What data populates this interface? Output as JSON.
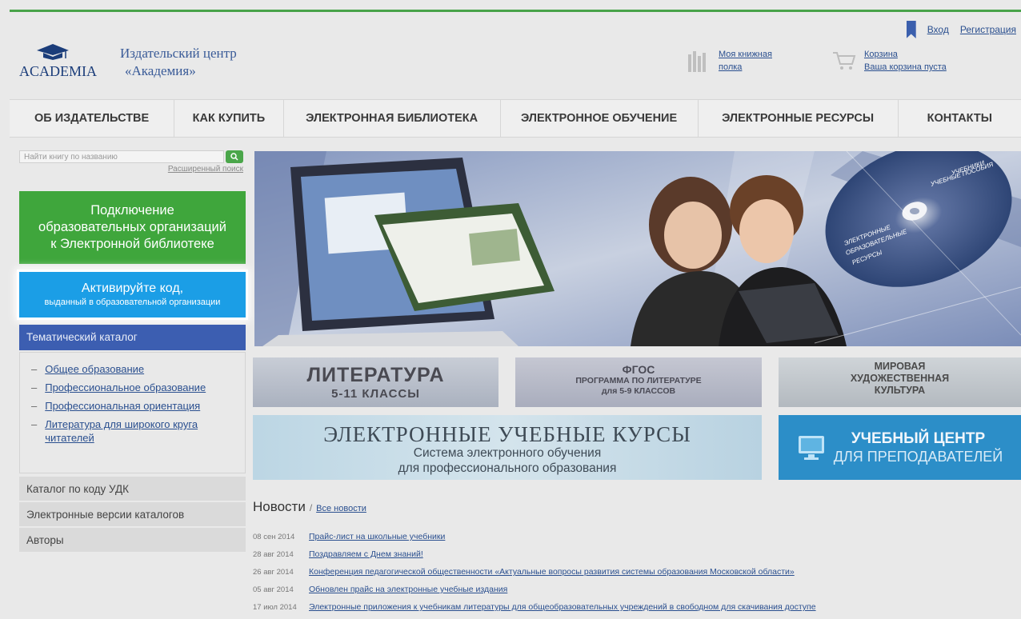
{
  "auth": {
    "login": "Вход",
    "register": "Регистрация"
  },
  "logo": {
    "name": "ACADEMIA"
  },
  "brand": {
    "line1": "Издательский центр",
    "line2": "«Академия»"
  },
  "shelf": {
    "line1": "Моя книжная",
    "line2": "полка"
  },
  "cart": {
    "title": "Корзина",
    "status": "Ваша корзина пуста"
  },
  "nav": [
    "ОБ ИЗДАТЕЛЬСТВЕ",
    "КАК КУПИТЬ",
    "ЭЛЕКТРОННАЯ БИБЛИОТЕКА",
    "ЭЛЕКТРОННОЕ ОБУЧЕНИЕ",
    "ЭЛЕКТРОННЫЕ РЕСУРСЫ",
    "КОНТАКТЫ"
  ],
  "search": {
    "placeholder": "Найти книгу по названию",
    "advanced": "Расширенный поиск"
  },
  "green_button": {
    "line1": "Подключение",
    "line2": "образовательных организаций",
    "line3": "к Электронной библиотеке"
  },
  "blue_button": {
    "line1": "Активируйте код,",
    "line2": "выданный в образовательной организации"
  },
  "catalog": {
    "title": "Тематический каталог",
    "items": [
      "Общее образование",
      "Профессиональное образование",
      "Профессиональная ориентация",
      "Литература для широкого круга читателей"
    ]
  },
  "side_items": [
    "Каталог по коду УДК",
    "Электронные версии каталогов",
    "Авторы"
  ],
  "banner": {
    "disc_top_1": "УЧЕБНИКИ",
    "disc_top_2": "УЧЕБНЫЕ ПОСОБИЯ",
    "disc_1": "ЭЛЕКТРОННЫЕ",
    "disc_2": "ОБРАЗОВАТЕЛЬНЫЕ",
    "disc_3": "РЕСУРСЫ"
  },
  "promos": {
    "literature": {
      "title": "ЛИТЕРАТУРА",
      "subtitle": "5-11 КЛАССЫ"
    },
    "fgos": {
      "line1": "ФГОС",
      "line2": "ПРОГРАММА ПО ЛИТЕРАТУРЕ",
      "line3": "для 5-9 КЛАССОВ"
    },
    "mhk": {
      "line1": "МИРОВАЯ",
      "line2": "ХУДОЖЕСТВЕННАЯ",
      "line3": "КУЛЬТУРА"
    },
    "ecourses": {
      "title": "ЭЛЕКТРОННЫЕ УЧЕБНЫЕ КУРСЫ",
      "line2": "Система электронного обучения",
      "line3": "для профессионального образования"
    },
    "center": {
      "line1": "УЧЕБНЫЙ ЦЕНТР",
      "line2": "ДЛЯ ПРЕПОДАВАТЕЛЕЙ"
    }
  },
  "news": {
    "title": "Новости",
    "separator": "/",
    "all_link": "Все новости",
    "items": [
      {
        "date": "08 сен 2014",
        "text": "Прайс-лист на школьные учебники"
      },
      {
        "date": "28 авг 2014",
        "text": "Поздравляем с Днем знаний!"
      },
      {
        "date": "26 авг 2014",
        "text": "Конференция педагогической общественности «Актуальные вопросы развития системы образования Московской области»"
      },
      {
        "date": "05 авг 2014",
        "text": "Обновлен прайс на электронные учебные издания"
      },
      {
        "date": "17 июл 2014",
        "text": "Электронные приложения к учебникам литературы для общеобразовательных учреждений в свободном для скачивания доступе"
      }
    ]
  },
  "colors": {
    "green": "#3fa63c",
    "blue": "#1b9ee6",
    "nav_blue": "#3c5eb1",
    "link": "#2a4f8f"
  }
}
